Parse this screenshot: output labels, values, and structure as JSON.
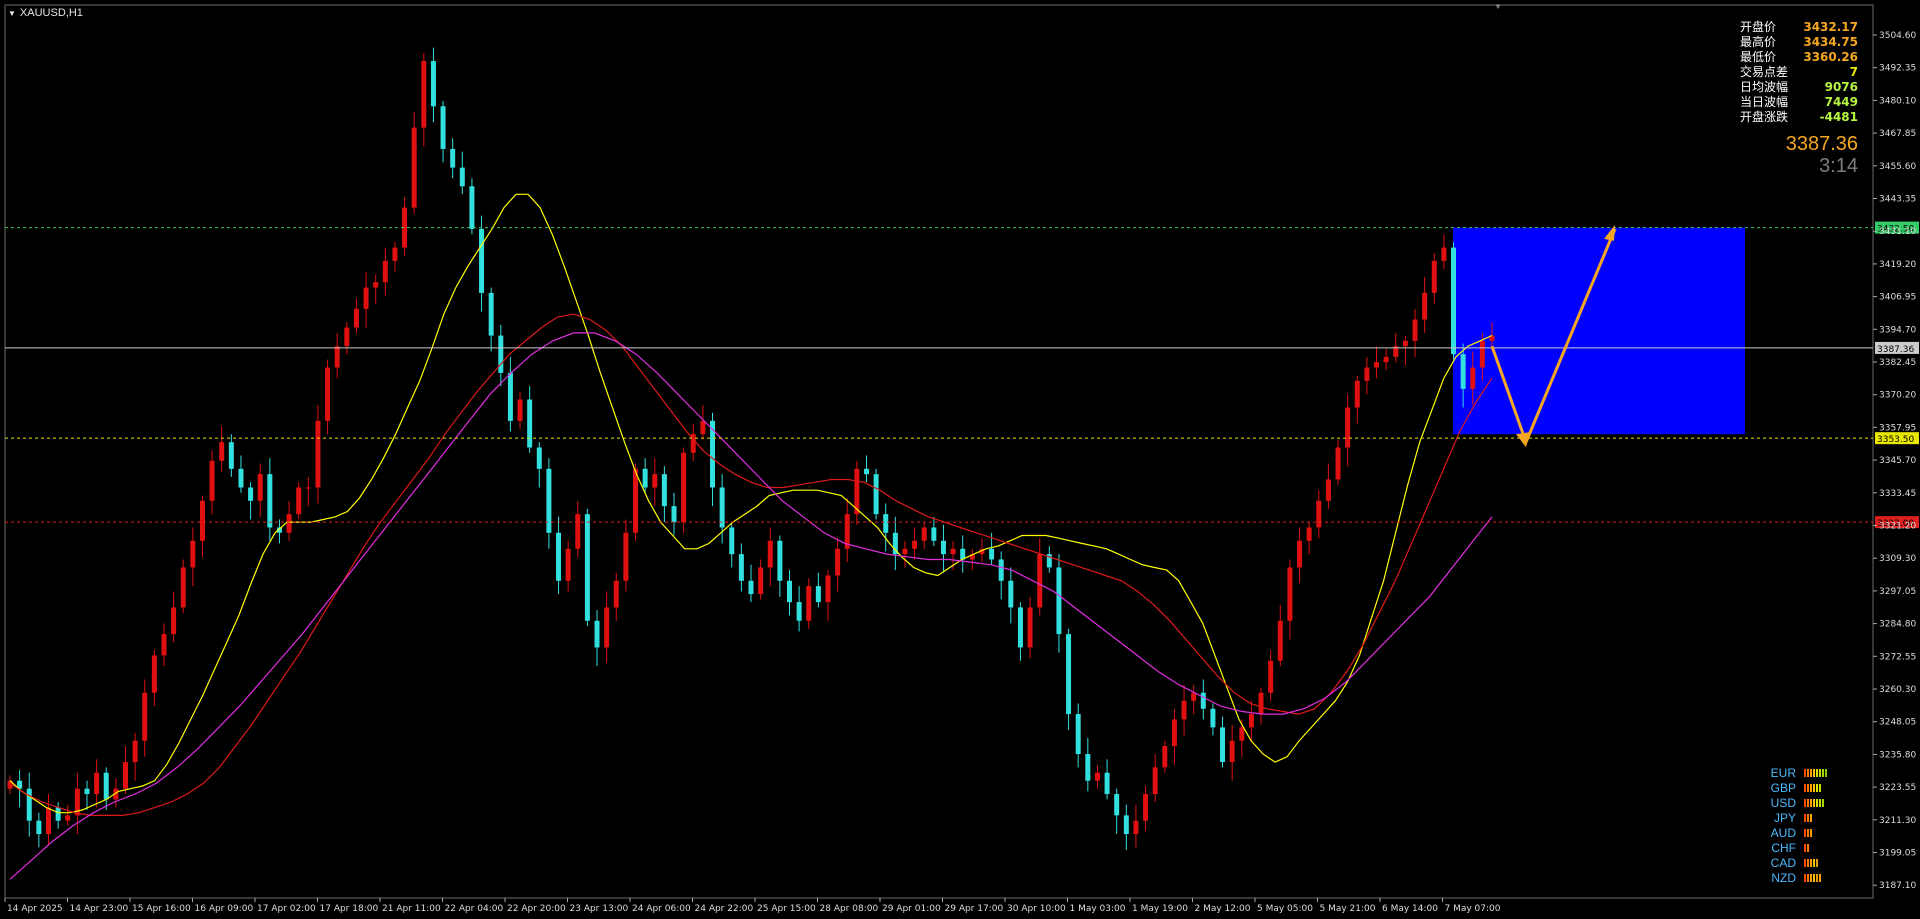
{
  "chart_data": {
    "type": "candlestick",
    "symbol": "XAUUSD,H1",
    "ylim": [
      3181,
      3516
    ],
    "y_ticks": [
      "3504.60",
      "3492.35",
      "3480.10",
      "3467.85",
      "3455.60",
      "3443.35",
      "3431.10",
      "3419.20",
      "3406.95",
      "3394.70",
      "3382.45",
      "3370.20",
      "3357.95",
      "3345.70",
      "3333.45",
      "3321.20",
      "3309.30",
      "3297.05",
      "3284.80",
      "3272.55",
      "3260.30",
      "3248.05",
      "3235.80",
      "3223.55",
      "3211.30",
      "3199.05",
      "3187.10"
    ],
    "x_ticks": [
      "14 Apr 2025",
      "14 Apr 23:00",
      "15 Apr 16:00",
      "16 Apr 09:00",
      "17 Apr 02:00",
      "17 Apr 18:00",
      "21 Apr 11:00",
      "22 Apr 04:00",
      "22 Apr 20:00",
      "23 Apr 13:00",
      "24 Apr 06:00",
      "24 Apr 22:00",
      "25 Apr 15:00",
      "28 Apr 08:00",
      "29 Apr 01:00",
      "29 Apr 17:00",
      "30 Apr 10:00",
      "1 May 03:00",
      "1 May 19:00",
      "2 May 12:00",
      "5 May 05:00",
      "5 May 21:00",
      "6 May 14:00",
      "7 May 07:00"
    ],
    "closes": [
      3225,
      3222,
      3210,
      3205,
      3215,
      3210,
      3212,
      3222,
      3220,
      3228,
      3218,
      3222,
      3232,
      3240,
      3258,
      3272,
      3280,
      3290,
      3305,
      3315,
      3330,
      3345,
      3352,
      3342,
      3335,
      3330,
      3340,
      3320,
      3318,
      3325,
      3335,
      3335,
      3360,
      3380,
      3388,
      3395,
      3402,
      3410,
      3412,
      3420,
      3425,
      3440,
      3470,
      3495,
      3478,
      3462,
      3455,
      3448,
      3432,
      3408,
      3392,
      3378,
      3360,
      3368,
      3350,
      3342,
      3318,
      3300,
      3312,
      3325,
      3285,
      3275,
      3290,
      3300,
      3318,
      3342,
      3335,
      3340,
      3328,
      3322,
      3348,
      3355,
      3360,
      3335,
      3320,
      3310,
      3300,
      3295,
      3305,
      3315,
      3300,
      3292,
      3285,
      3298,
      3292,
      3302,
      3312,
      3325,
      3342,
      3340,
      3325,
      3318,
      3310,
      3312,
      3315,
      3320,
      3315,
      3310,
      3312,
      3308,
      3310,
      3312,
      3308,
      3300,
      3290,
      3275,
      3290,
      3310,
      3305,
      3280,
      3250,
      3235,
      3225,
      3228,
      3220,
      3212,
      3205,
      3210,
      3220,
      3230,
      3238,
      3248,
      3255,
      3258,
      3252,
      3245,
      3232,
      3240,
      3245,
      3250,
      3258,
      3270,
      3285,
      3305,
      3315,
      3320,
      3330,
      3338,
      3350,
      3365,
      3375,
      3380,
      3382,
      3384,
      3388,
      3390,
      3398,
      3408,
      3420,
      3425,
      3385,
      3372,
      3380,
      3390,
      3392
    ],
    "series": [
      {
        "name": "MA fast",
        "color": "#ffff00",
        "values": [
          3225,
          3221,
          3218,
          3215,
          3213,
          3213,
          3214,
          3216,
          3218,
          3221,
          3222,
          3223,
          3225,
          3231,
          3239,
          3248,
          3257,
          3267,
          3277,
          3287,
          3299,
          3310,
          3318,
          3322,
          3322,
          3322,
          3323,
          3324,
          3326,
          3331,
          3338,
          3346,
          3355,
          3365,
          3375,
          3387,
          3400,
          3410,
          3418,
          3425,
          3432,
          3440,
          3445,
          3445,
          3440,
          3430,
          3418,
          3405,
          3392,
          3378,
          3365,
          3352,
          3340,
          3330,
          3322,
          3317,
          3312,
          3312,
          3314,
          3318,
          3322,
          3325,
          3328,
          3332,
          3333,
          3334,
          3334,
          3334,
          3333,
          3332,
          3328,
          3324,
          3320,
          3314,
          3309,
          3305,
          3303,
          3302,
          3305,
          3308,
          3310,
          3312,
          3313,
          3315,
          3317,
          3317,
          3317,
          3316,
          3315,
          3314,
          3313,
          3312,
          3310,
          3308,
          3306,
          3305,
          3304,
          3300,
          3292,
          3284,
          3272,
          3260,
          3248,
          3240,
          3235,
          3232,
          3234,
          3240,
          3245,
          3250,
          3255,
          3262,
          3272,
          3286,
          3300,
          3318,
          3336,
          3352,
          3364,
          3376,
          3384,
          3388,
          3390,
          3392
        ]
      },
      {
        "name": "MA medium",
        "color": "#dd1a1a",
        "values": [
          3224,
          3220,
          3217,
          3215,
          3213,
          3212,
          3212,
          3212,
          3213,
          3215,
          3217,
          3220,
          3224,
          3230,
          3238,
          3246,
          3255,
          3264,
          3273,
          3283,
          3293,
          3303,
          3313,
          3322,
          3330,
          3338,
          3346,
          3355,
          3363,
          3371,
          3378,
          3385,
          3390,
          3395,
          3399,
          3400,
          3398,
          3394,
          3388,
          3380,
          3372,
          3364,
          3356,
          3349,
          3344,
          3340,
          3337,
          3335,
          3335,
          3336,
          3337,
          3338,
          3338,
          3337,
          3334,
          3330,
          3327,
          3324,
          3322,
          3320,
          3318,
          3316,
          3314,
          3312,
          3310,
          3308,
          3306,
          3304,
          3302,
          3300,
          3296,
          3291,
          3285,
          3278,
          3271,
          3264,
          3258,
          3254,
          3252,
          3251,
          3250,
          3252,
          3258,
          3266,
          3276,
          3288,
          3300,
          3314,
          3328,
          3342,
          3356,
          3367,
          3376
        ]
      },
      {
        "name": "MA slow",
        "color": "#e02ee0",
        "values": [
          3188,
          3195,
          3202,
          3208,
          3213,
          3217,
          3220,
          3224,
          3230,
          3237,
          3245,
          3253,
          3262,
          3271,
          3280,
          3290,
          3300,
          3310,
          3320,
          3330,
          3340,
          3350,
          3360,
          3370,
          3378,
          3385,
          3390,
          3393,
          3393,
          3390,
          3385,
          3378,
          3370,
          3362,
          3354,
          3346,
          3338,
          3330,
          3324,
          3318,
          3314,
          3312,
          3310,
          3309,
          3308,
          3308,
          3307,
          3306,
          3304,
          3300,
          3296,
          3290,
          3284,
          3278,
          3272,
          3266,
          3261,
          3257,
          3253,
          3251,
          3250,
          3250,
          3252,
          3256,
          3262,
          3270,
          3278,
          3286,
          3294,
          3304,
          3314,
          3324
        ]
      }
    ],
    "h_lines": [
      {
        "price": 3432.5,
        "label": "3432.50",
        "color": "#33cc66"
      },
      {
        "price": 3387.36,
        "label": "3387.36",
        "color": "#cccccc"
      },
      {
        "price": 3353.5,
        "label": "3353.50",
        "color": "#e8e800"
      },
      {
        "price": 3322.0,
        "label": "3322.00",
        "color": "#e02020"
      }
    ],
    "zone": {
      "from": 3355,
      "to": 3432.5,
      "color": "#0000ff"
    },
    "projection": [
      {
        "x": "7 May 07:00",
        "price": 3388
      },
      {
        "label": "down",
        "price": 3352
      },
      {
        "label": "up",
        "price": 3432
      }
    ],
    "grid": false
  },
  "info_panel": {
    "rows": [
      {
        "label": "开盘价",
        "value": "3432.17",
        "color": "#f5a623"
      },
      {
        "label": "最高价",
        "value": "3434.75",
        "color": "#f5a623"
      },
      {
        "label": "最低价",
        "value": "3360.26",
        "color": "#f5a623"
      },
      {
        "label": "交易点差",
        "value": "7",
        "color": "#e8e800"
      },
      {
        "label": "日均波幅",
        "value": "9076",
        "color": "#b6f542"
      },
      {
        "label": "当日波幅",
        "value": "7449",
        "color": "#b6f542"
      },
      {
        "label": "开盘涨跌",
        "value": "-4481",
        "color": "#b6f542"
      }
    ],
    "current_price": "3387.36",
    "timer": "3:14"
  },
  "currency_strength": [
    {
      "name": "EUR",
      "bars": [
        "#ff4a00",
        "#ff7a00",
        "#ffa000",
        "#ffc000",
        "#e0e000",
        "#c8e000",
        "#a8d800",
        "#88cc00"
      ]
    },
    {
      "name": "GBP",
      "bars": [
        "#ff4a00",
        "#ff7a00",
        "#ffa000",
        "#ffc000",
        "#e0e000",
        "#c8e000"
      ]
    },
    {
      "name": "USD",
      "bars": [
        "#ff4a00",
        "#ff7a00",
        "#ffa000",
        "#ffc000",
        "#e0e000",
        "#c8e000",
        "#a8d800"
      ]
    },
    {
      "name": "JPY",
      "bars": [
        "#ff4a00",
        "#ff7a00",
        "#ffa000"
      ]
    },
    {
      "name": "AUD",
      "bars": [
        "#ff4a00",
        "#ff7a00",
        "#ffa000"
      ]
    },
    {
      "name": "CHF",
      "bars": [
        "#ff4a00",
        "#ff7a00"
      ]
    },
    {
      "name": "CAD",
      "bars": [
        "#ff4a00",
        "#ff7a00",
        "#ffa000",
        "#ffc000",
        "#e0a000"
      ]
    },
    {
      "name": "NZD",
      "bars": [
        "#ff4a00",
        "#ff7a00",
        "#ffa000",
        "#ffc000",
        "#e0a000",
        "#ffa000"
      ]
    }
  ]
}
